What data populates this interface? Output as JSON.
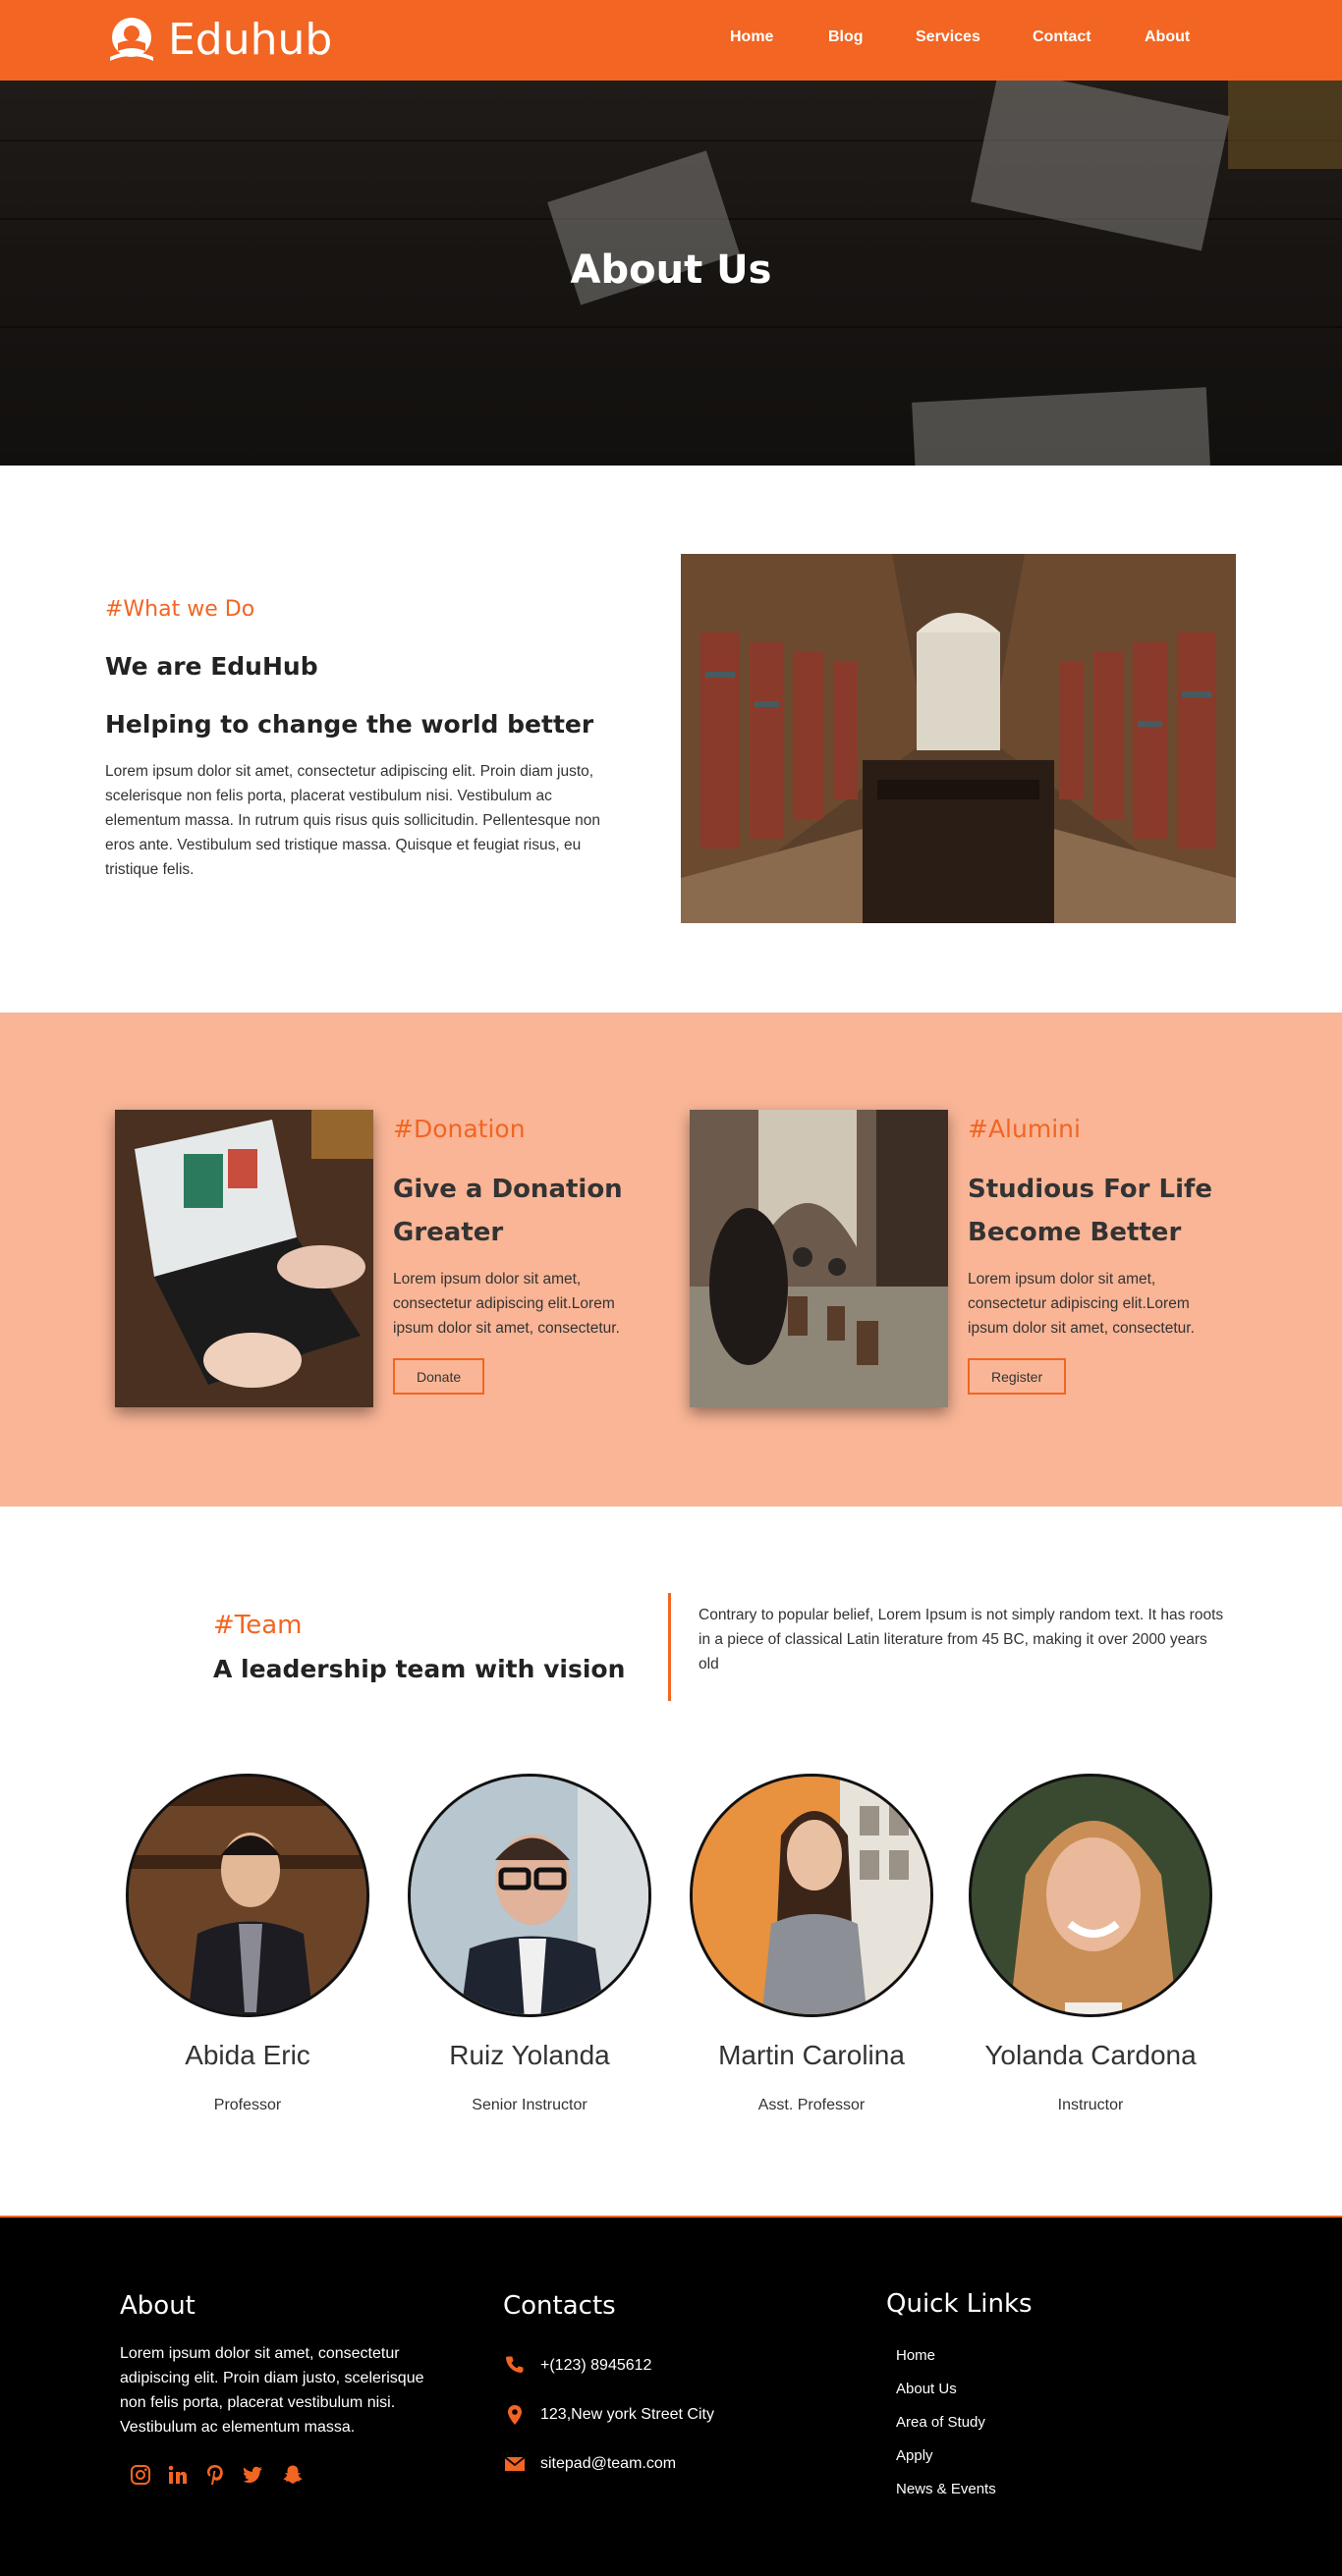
{
  "brand": {
    "name": "Eduhub",
    "accent": "#f26522"
  },
  "nav": {
    "items": [
      "Home",
      "Blog",
      "Services",
      "Contact",
      "About"
    ]
  },
  "hero": {
    "title": "About Us"
  },
  "intro": {
    "tag": "#What we Do",
    "heading": "We are EduHub",
    "subheading": "Helping to change the world better",
    "body": "Lorem ipsum dolor sit amet, consectetur adipiscing elit. Proin diam justo, scelerisque non felis porta, placerat vestibulum nisi. Vestibulum ac elementum massa. In rutrum quis risus quis sollicitudin. Pellentesque non eros ante. Vestibulum sed tristique massa. Quisque et feugiat risus, eu tristique felis."
  },
  "band": {
    "color": "#f9b596",
    "cards": [
      {
        "tag": "#Donation",
        "title": "Give a Donation Greater",
        "text": "Lorem ipsum dolor sit amet, consectetur adipiscing elit.Lorem ipsum dolor sit amet, consectetur.",
        "button": "Donate"
      },
      {
        "tag": "#Alumini",
        "title": "Studious For Life Become Better",
        "text": "Lorem ipsum dolor sit amet, consectetur adipiscing elit.Lorem ipsum dolor sit amet, consectetur.",
        "button": "Register"
      }
    ]
  },
  "team": {
    "tag": "#Team",
    "heading": "A leadership team with vision",
    "description": "Contrary to popular belief, Lorem Ipsum is not simply random text. It has roots in a piece of classical Latin literature from 45 BC, making it over 2000 years old",
    "members": [
      {
        "name": "Abida Eric",
        "role": "Professor"
      },
      {
        "name": "Ruiz Yolanda",
        "role": "Senior Instructor"
      },
      {
        "name": "Martin Carolina",
        "role": "Asst. Professor"
      },
      {
        "name": "Yolanda Cardona",
        "role": "Instructor"
      }
    ]
  },
  "footer": {
    "about": {
      "heading": "About",
      "text": "Lorem ipsum dolor sit amet, consectetur adipiscing elit. Proin diam justo, scelerisque non felis porta, placerat vestibulum nisi. Vestibulum ac elementum massa.",
      "social": [
        "instagram-icon",
        "linkedin-icon",
        "pinterest-icon",
        "twitter-icon",
        "snapchat-icon"
      ]
    },
    "contacts": {
      "heading": "Contacts",
      "phone": "+(123) 8945612",
      "address": "123,New york Street City",
      "email": "sitepad@team.com"
    },
    "links": {
      "heading": "Quick Links",
      "items": [
        "Home",
        "About Us",
        "Area of Study",
        "Apply",
        "News & Events"
      ]
    }
  }
}
